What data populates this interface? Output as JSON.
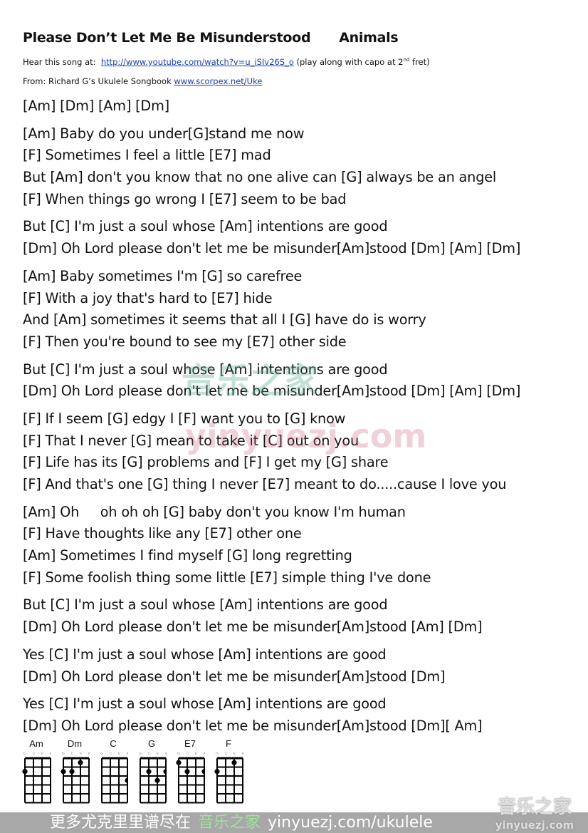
{
  "header": {
    "title": "Please Don’t Let Me Be Misunderstood",
    "artist": "Animals",
    "hear_prefix": "Hear this song at:",
    "hear_link": "http://www.youtube.com/watch?v=u_iSIv26S_o",
    "hear_note_a": "(play along with capo at 2",
    "hear_note_sup": "nd",
    "hear_note_b": " fret)",
    "from_prefix": "From:  Richard G’s Ukulele Songbook",
    "from_link": "www.scorpex.net/Uke"
  },
  "stanzas": [
    [
      "[Am] [Dm] [Am] [Dm]"
    ],
    [
      "[Am] Baby do you under[G]stand me now",
      "[F] Sometimes I feel a little [E7] mad",
      "But [Am] don't you know that no one alive can [G] always be an angel",
      "[F] When things go wrong I [E7] seem to be bad"
    ],
    [
      "But [C] I'm just a soul whose [Am] intentions are good",
      "[Dm] Oh Lord please don't let me be misunder[Am]stood [Dm] [Am] [Dm]"
    ],
    [
      "[Am] Baby sometimes I'm [G] so carefree",
      "[F] With a joy that's hard to [E7] hide",
      "And [Am] sometimes it seems that all I [G] have do is worry",
      "[F] Then you're bound to see my [E7] other side"
    ],
    [
      "But [C] I'm just a soul whose [Am] intentions are good",
      "[Dm] Oh Lord please don't let me be misunder[Am]stood [Dm] [Am] [Dm]"
    ],
    [
      "[F] If I seem [G] edgy I [F] want you to [G] know",
      "[F] That I never [G] mean to take it [C] out on you",
      "[F] Life has its [G] problems and [F] I get my [G] share",
      "[F] And that's one [G] thing I never [E7] meant to do.....cause I love you"
    ],
    [
      "[Am] Oh     oh oh oh [G] baby don't you know I'm human",
      "[F] Have thoughts like any [E7] other one",
      "[Am] Sometimes I find myself [G] long regretting",
      "[F] Some foolish thing some little [E7] simple thing I've done"
    ],
    [
      "But [C] I'm just a soul whose [Am] intentions are good",
      "[Dm] Oh Lord please don't let me be misunder[Am]stood [Am] [Dm]"
    ],
    [
      "Yes [C] I'm just a soul whose [Am] intentions are good",
      "[Dm] Oh Lord please don't let me be misunder[Am]stood [Dm]"
    ],
    [
      "Yes [C] I'm just a soul whose [Am] intentions are good",
      "[Dm] Oh Lord please don't let me be misunder[Am]stood [Dm][ Am]"
    ]
  ],
  "string_labels": "G C E A",
  "chords": [
    {
      "name": "Am",
      "frets": [
        2,
        0,
        0,
        0
      ]
    },
    {
      "name": "Dm",
      "frets": [
        2,
        2,
        1,
        0
      ]
    },
    {
      "name": "C",
      "frets": [
        0,
        0,
        0,
        3
      ]
    },
    {
      "name": "G",
      "frets": [
        0,
        2,
        3,
        2
      ]
    },
    {
      "name": "E7",
      "frets": [
        1,
        2,
        0,
        2
      ]
    },
    {
      "name": "F",
      "frets": [
        2,
        0,
        1,
        0
      ]
    }
  ],
  "watermark": {
    "cn": "音乐之家",
    "en": "yinyuezj.com"
  },
  "footer": {
    "cn": "更多尤克里里谱尽在",
    "brand": "音乐之家",
    "url": "yinyuezj.com/ukulele"
  },
  "logo": {
    "cn": "音乐之家",
    "en": "yinyuezj.com"
  }
}
